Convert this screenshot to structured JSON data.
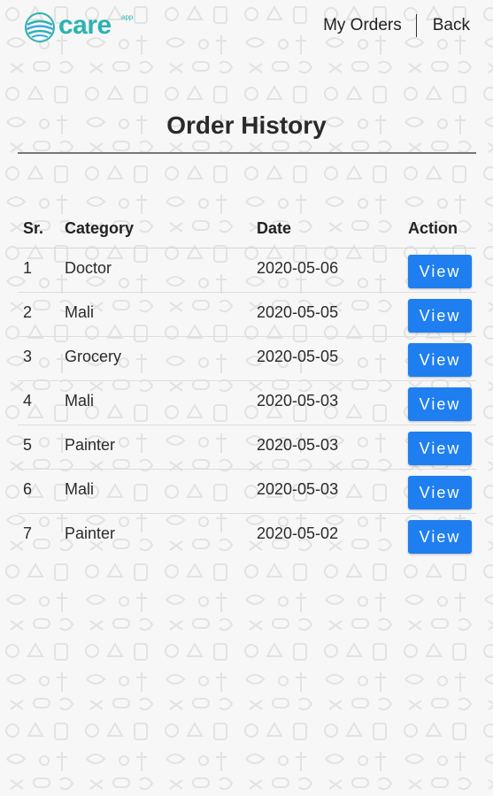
{
  "header": {
    "logo_text": "care",
    "logo_sup": "app",
    "nav": {
      "my_orders": "My Orders",
      "back": "Back"
    }
  },
  "page": {
    "title": "Order History"
  },
  "table": {
    "headers": {
      "sr": "Sr.",
      "category": "Category",
      "date": "Date",
      "action": "Action"
    },
    "rows": [
      {
        "sr": "1",
        "category": "Doctor",
        "date": "2020-05-06",
        "action": "View"
      },
      {
        "sr": "2",
        "category": "Mali",
        "date": "2020-05-05",
        "action": "View"
      },
      {
        "sr": "3",
        "category": "Grocery",
        "date": "2020-05-05",
        "action": "View"
      },
      {
        "sr": "4",
        "category": "Mali",
        "date": "2020-05-03",
        "action": "View"
      },
      {
        "sr": "5",
        "category": "Painter",
        "date": "2020-05-03",
        "action": "View"
      },
      {
        "sr": "6",
        "category": "Mali",
        "date": "2020-05-03",
        "action": "View"
      },
      {
        "sr": "7",
        "category": "Painter",
        "date": "2020-05-02",
        "action": "View"
      }
    ]
  },
  "colors": {
    "brand": "#2bb3b1",
    "button": "#1f7ff0"
  }
}
